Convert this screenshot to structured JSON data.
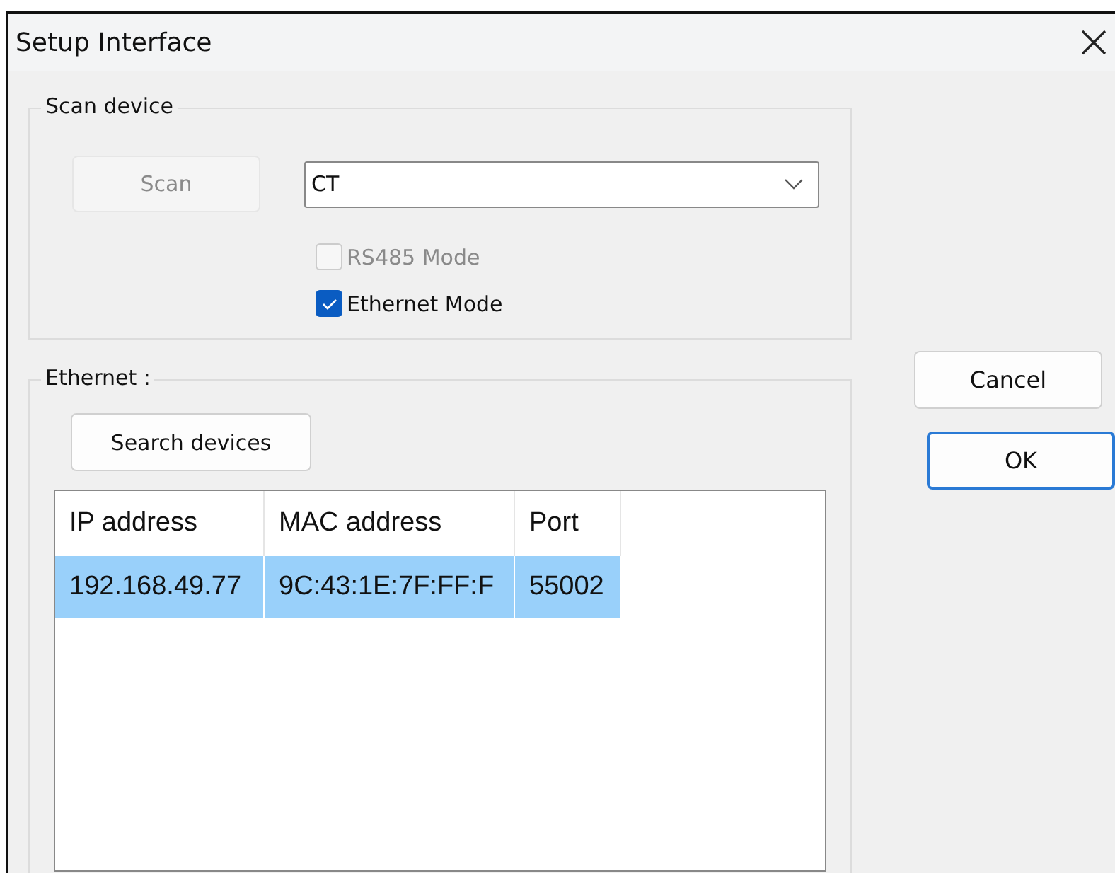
{
  "window": {
    "title": "Setup Interface"
  },
  "scan_group": {
    "title": "Scan device",
    "scan_button": {
      "label": "Scan",
      "disabled": true
    },
    "device_combo": {
      "value": "CT"
    },
    "options": [
      {
        "label": "RS485 Mode",
        "checked": false,
        "disabled": true
      },
      {
        "label": "Ethernet Mode",
        "checked": true,
        "disabled": false
      }
    ]
  },
  "ethernet_group": {
    "title": "Ethernet :",
    "search_button": {
      "label": "Search devices"
    },
    "table": {
      "columns": [
        "IP address",
        "MAC address",
        "Port"
      ],
      "rows": [
        {
          "cells": [
            "192.168.49.77",
            "9C:43:1E:7F:FF:F",
            "55002"
          ],
          "selected": true
        }
      ]
    }
  },
  "buttons": [
    {
      "label": "Cancel",
      "default": false
    },
    {
      "label": "OK",
      "default": true
    }
  ]
}
